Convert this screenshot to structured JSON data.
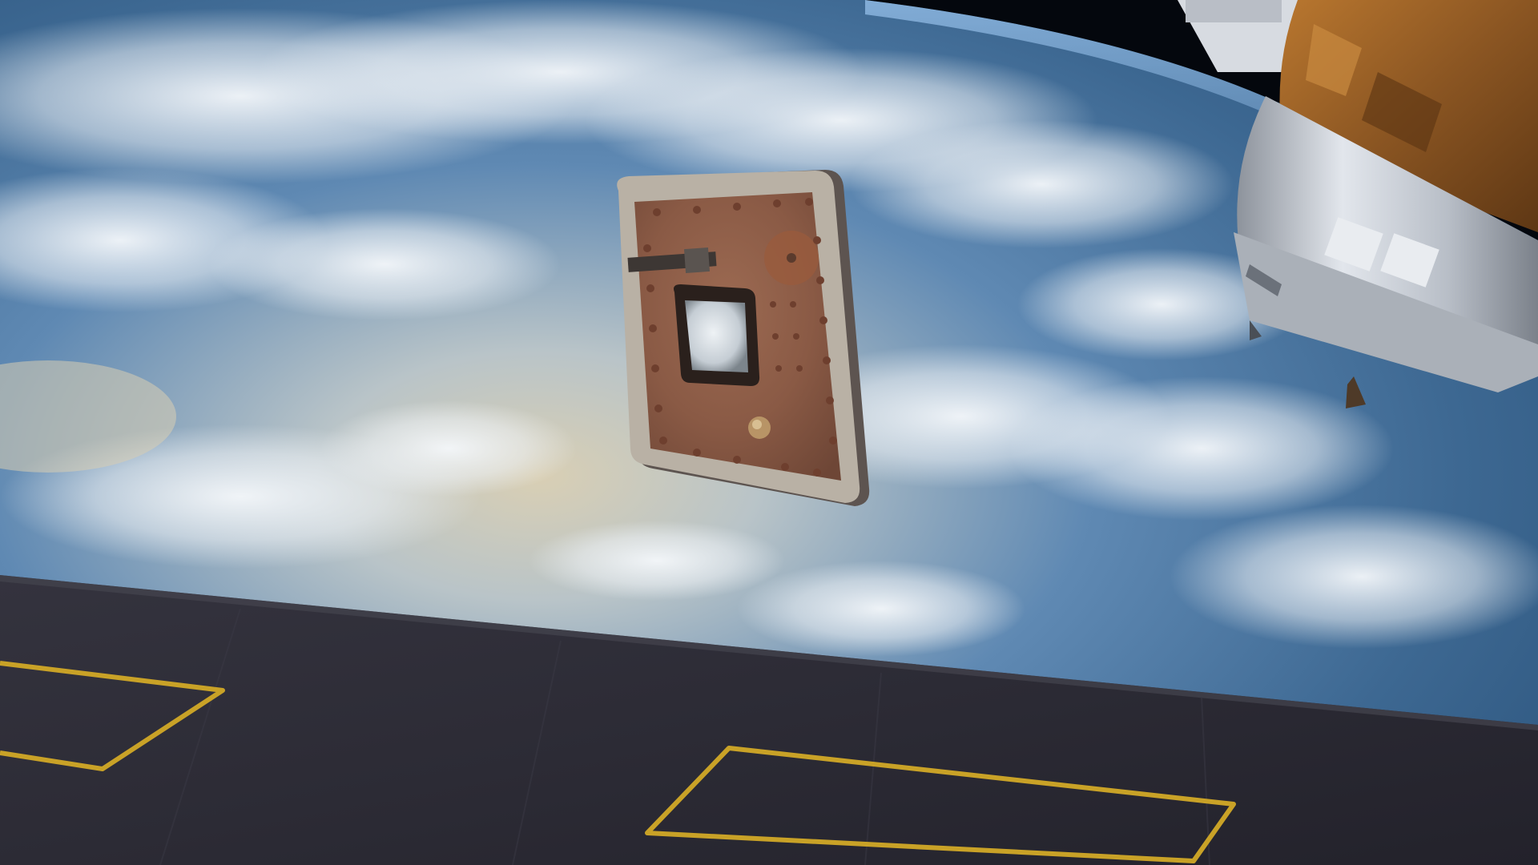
{
  "scene": {
    "subjects": [
      "earth-horizon",
      "floating-hatch",
      "docked-spacecraft",
      "foreground-hull-panel"
    ],
    "colors": {
      "space": "#04070d",
      "atmosphere_glow": "#7fb2e6",
      "ocean_deep": "#2f5a86",
      "ocean_mid": "#4b7aa6",
      "cloud": "#eef2f6",
      "sunlit_haze": "#cdbf9c",
      "hatch_rust": "#8a5a45",
      "hatch_rim": "#b9b1a5",
      "spacecraft_gold": "#8a5522",
      "spacecraft_silver": "#c9ced6",
      "hull_dark": "#2c2b35",
      "hull_marking": "#c9a227"
    }
  }
}
